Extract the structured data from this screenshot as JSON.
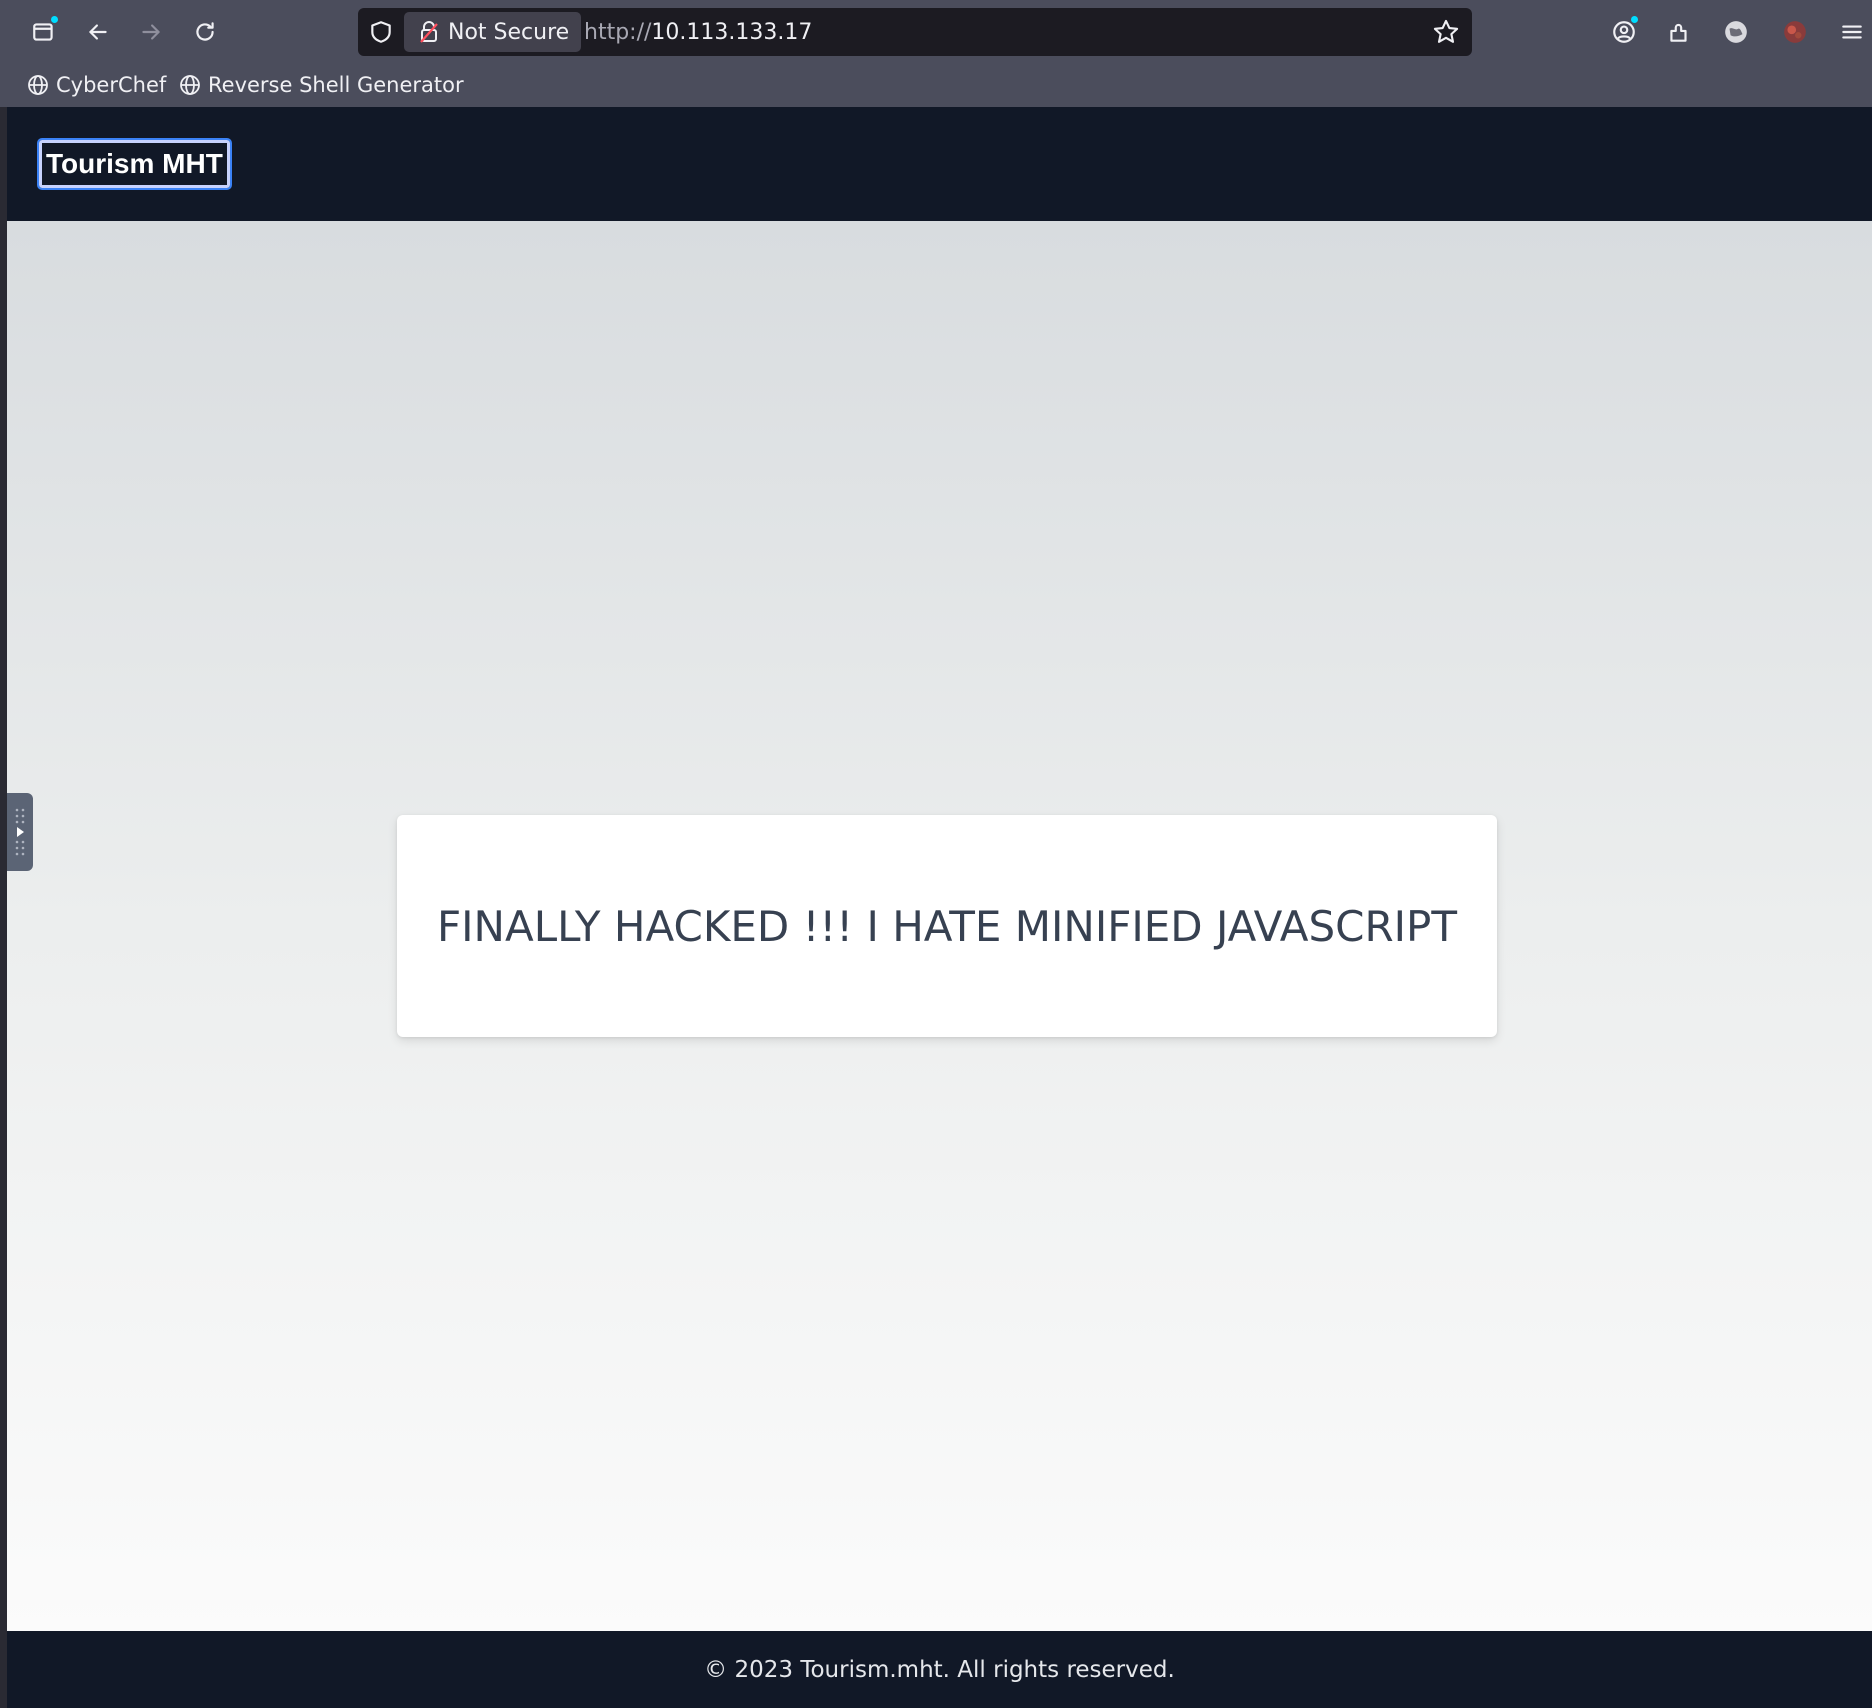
{
  "browser": {
    "security_label": "Not Secure",
    "url_scheme": "http://",
    "url_host": "10.113.133.17",
    "icons": {
      "tabs": "tab-overview-icon",
      "back": "back-arrow-icon",
      "forward": "forward-arrow-icon",
      "reload": "reload-icon",
      "shield": "tracking-shield-icon",
      "lock": "broken-lock-icon",
      "bookmark_star": "star-icon",
      "account": "account-icon",
      "extensions": "extensions-icon",
      "extension_a": "extension-globe-icon",
      "extension_b": "extension-red-icon",
      "menu": "hamburger-menu-icon"
    },
    "bookmarks": [
      {
        "label": "CyberChef",
        "icon": "globe-icon"
      },
      {
        "label": "Reverse Shell Generator",
        "icon": "globe-icon"
      }
    ]
  },
  "navbar": {
    "brand": "Tourism MHT"
  },
  "main": {
    "message": "FINALLY HACKED !!! I HATE MINIFIED JAVASCRIPT"
  },
  "footer": {
    "text": "© 2023 Tourism.mht. All rights reserved."
  },
  "colors": {
    "navbar_bg": "#111827",
    "chrome_bg": "#4b4d5c",
    "card_text": "#374151"
  }
}
